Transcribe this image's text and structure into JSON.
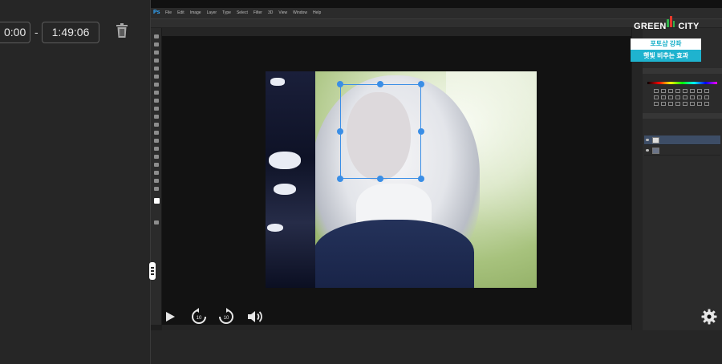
{
  "trim": {
    "start_time": "0:00",
    "separator": "-",
    "end_time": "1:49:06"
  },
  "photoshop": {
    "app_logo": "Ps",
    "menu": [
      "File",
      "Edit",
      "Image",
      "Layer",
      "Type",
      "Select",
      "Filter",
      "3D",
      "View",
      "Window",
      "Help"
    ]
  },
  "watermark": {
    "brand_left": "GREEN",
    "brand_right": "CITY",
    "line1": "포토샵 강좌",
    "line2": "햇빛 비추는 효과"
  },
  "player": {
    "rewind_seconds": "10",
    "forward_seconds": "10"
  },
  "icons": {
    "trash": "trash-icon",
    "play": "play-icon",
    "rewind": "rewind-10-icon",
    "forward": "forward-10-icon",
    "volume": "volume-icon",
    "settings": "gear-icon"
  },
  "colors": {
    "background": "#262626",
    "selection_box": "#3a8ee6",
    "brand_green": "#2fb24a",
    "brand_cyan": "#1fb3cf"
  }
}
